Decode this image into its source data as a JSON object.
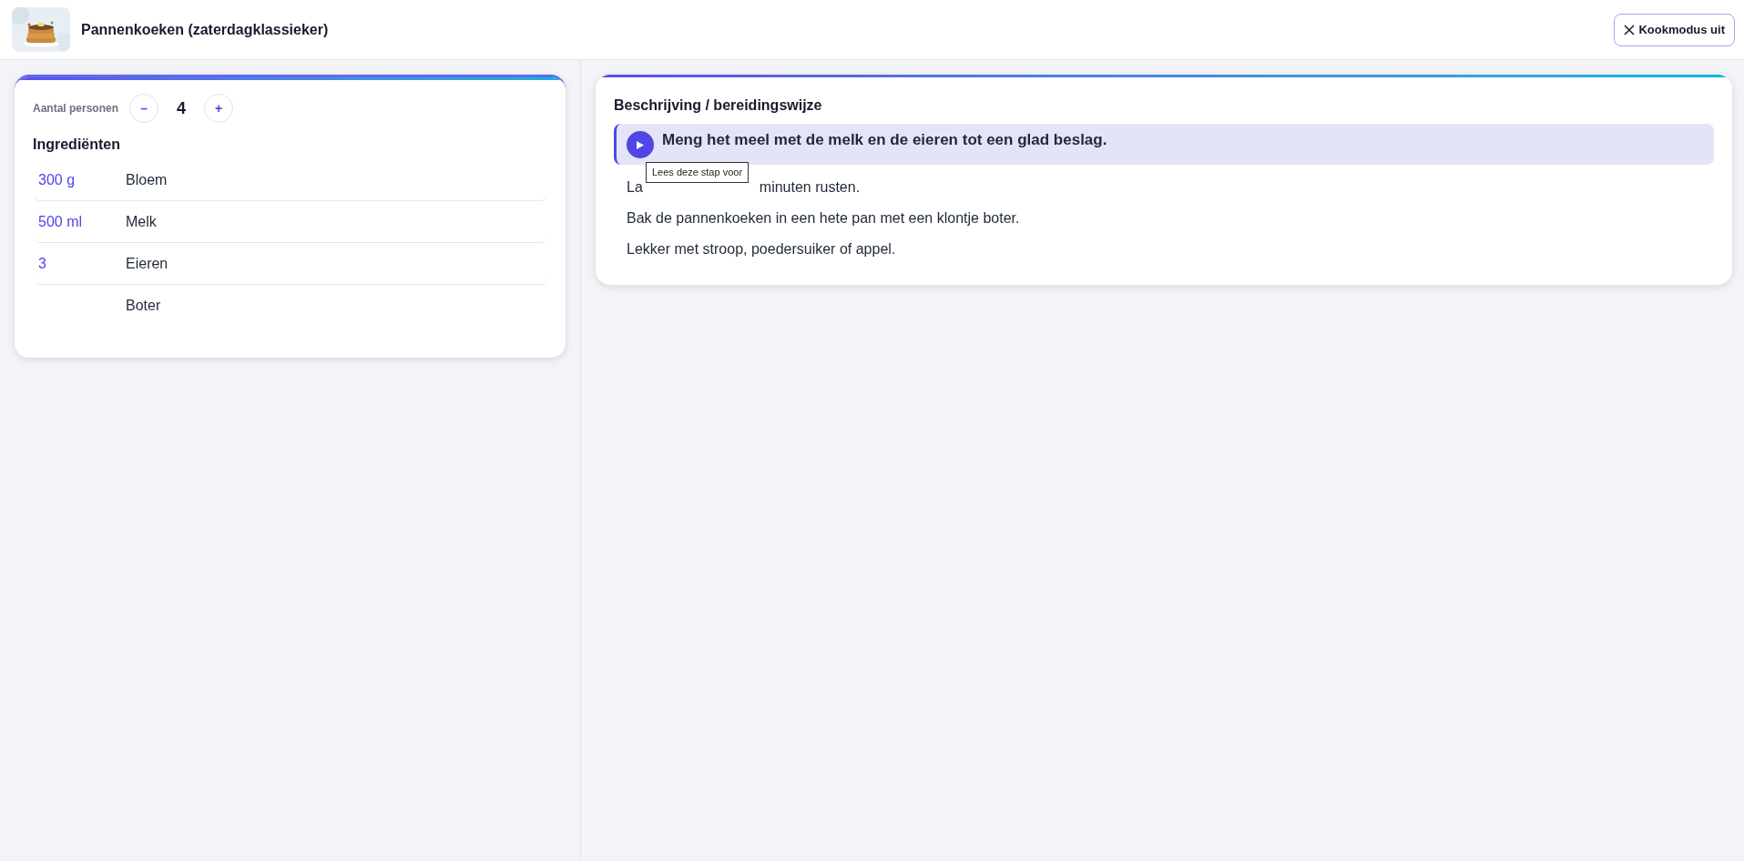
{
  "header": {
    "title": "Pannenkoeken (zaterdagklassieker)",
    "close_button": {
      "label": "Kookmodus uit"
    }
  },
  "servings": {
    "label": "Aantal personen",
    "decrement": "–",
    "count": "4",
    "increment": "+"
  },
  "ingredients": {
    "title": "Ingrediënten",
    "rows": [
      {
        "amount": "300 g",
        "name": "Bloem"
      },
      {
        "amount": "500 ml",
        "name": "Melk"
      },
      {
        "amount": "3",
        "name": "Eieren"
      },
      {
        "name": "Boter"
      }
    ]
  },
  "method": {
    "title": "Beschrijving / bereidingswijze",
    "steps": [
      {
        "text": "Meng het meel met de melk en de eieren tot een glad beslag.",
        "selected": true
      },
      {
        "visible_parts": [
          "La",
          "minuten rusten."
        ],
        "selected": false
      },
      {
        "text": "Bak de pannenkoeken in een hete pan met een klontje boter.",
        "selected": false
      },
      {
        "text": "Lekker met stroop, poedersuiker of appel.",
        "selected": false
      }
    ],
    "tooltip": "Lees deze stap voor"
  }
}
